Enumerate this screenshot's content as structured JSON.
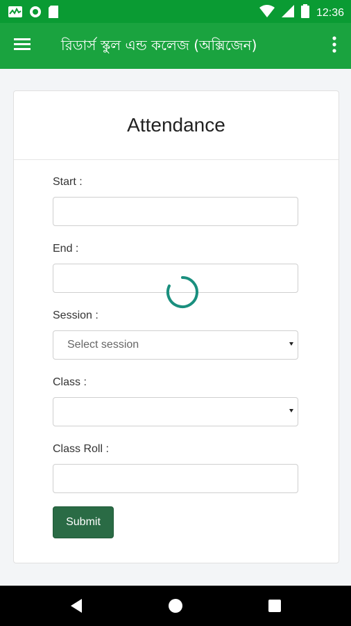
{
  "status_bar": {
    "time": "12:36",
    "icons": [
      "activity-icon",
      "record-icon",
      "sim-card-icon",
      "wifi-icon",
      "signal-icon",
      "battery-icon"
    ]
  },
  "app_bar": {
    "title": "রিডার্স স্কুল এন্ড কলেজ (অক্সিজেন)",
    "menu_icon": "hamburger-menu-icon",
    "more_icon": "more-vert-icon",
    "color": "#1aa33f"
  },
  "form": {
    "title": "Attendance",
    "fields": {
      "start_label": "Start :",
      "end_label": "End :",
      "session_label": "Session :",
      "session_placeholder": "Select session",
      "class_label": "Class :",
      "class_roll_label": "Class Roll :"
    },
    "submit_label": "Submit",
    "submit_color": "#2a6b45"
  },
  "loading": {
    "spinner_color": "#1a8f7e"
  },
  "nav_bar": {
    "icons": [
      "back-icon",
      "home-icon",
      "recent-apps-icon"
    ]
  }
}
